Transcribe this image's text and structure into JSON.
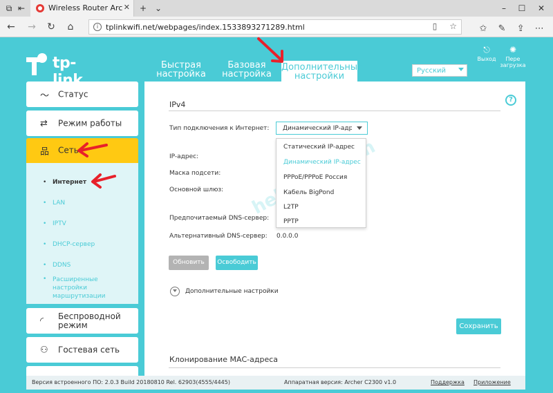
{
  "browser": {
    "tab_title": "Wireless Router Archer",
    "url": "tplinkwifi.net/webpages/index.1533893271289.html"
  },
  "header": {
    "logo_text": "tp-link",
    "nav": [
      {
        "line1": "Быстрая",
        "line2": "настройка"
      },
      {
        "line1": "Базовая",
        "line2": "настройка"
      },
      {
        "line1": "Дополнительные",
        "line2": "настройки"
      }
    ],
    "language": "Русский",
    "logout": "Выход",
    "reboot_line1": "Пере",
    "reboot_line2": "загрузка"
  },
  "sidebar": {
    "items": [
      {
        "label": "Статус",
        "icon": "pulse-icon"
      },
      {
        "label": "Режим работы",
        "icon": "swap-icon"
      },
      {
        "label": "Сеть",
        "icon": "network-icon"
      },
      {
        "label_line1": "Беспроводной",
        "label_line2": "режим",
        "icon": "wifi-icon"
      },
      {
        "label": "Гостевая сеть",
        "icon": "guest-icon"
      }
    ],
    "subitems": [
      {
        "label": "Интернет"
      },
      {
        "label": "LAN"
      },
      {
        "label": "IPTV"
      },
      {
        "label": "DHCP-сервер"
      },
      {
        "label": "DDNS"
      },
      {
        "label_line1": "Расширенные",
        "label_line2": "настройки",
        "label_line3": "маршрутизации"
      }
    ]
  },
  "main": {
    "section_title": "IPv4",
    "connection_label": "Тип подключения к Интернет:",
    "connection_value": "Динамический IP-адрес",
    "fields": {
      "ip": "IP-адрес:",
      "mask": "Маска подсети:",
      "gateway": "Основной шлюз:",
      "dns_primary": "Предпочитаемый DNS-сервер:",
      "dns_alt": "Альтернативный DNS-сервер:",
      "dns_alt_value": "0.0.0.0"
    },
    "dropdown_options": [
      "Статический IP-адрес",
      "Динамический IP-адрес",
      "PPPoE/PPPoE Россия",
      "Кабель BigPond",
      "L2TP",
      "PPTP"
    ],
    "renew_button": "Обновить",
    "release_button": "Освободить",
    "advanced_label": "Дополнительные настройки",
    "save_button": "Сохранить",
    "mac_section_title": "Клонирование МАС-адреса",
    "watermark": "help-wifi.com",
    "help": "?"
  },
  "footer": {
    "firmware": "Версия встроенного ПО: 2.0.3 Build 20180810 Rel. 62903(4555/4445)",
    "hardware": "Аппаратная версия: Archer C2300 v1.0",
    "support": "Поддержка",
    "app": "Приложение"
  },
  "colors": {
    "accent": "#4acbd6",
    "highlight": "#ffc912",
    "annotation": "#e8202a"
  }
}
